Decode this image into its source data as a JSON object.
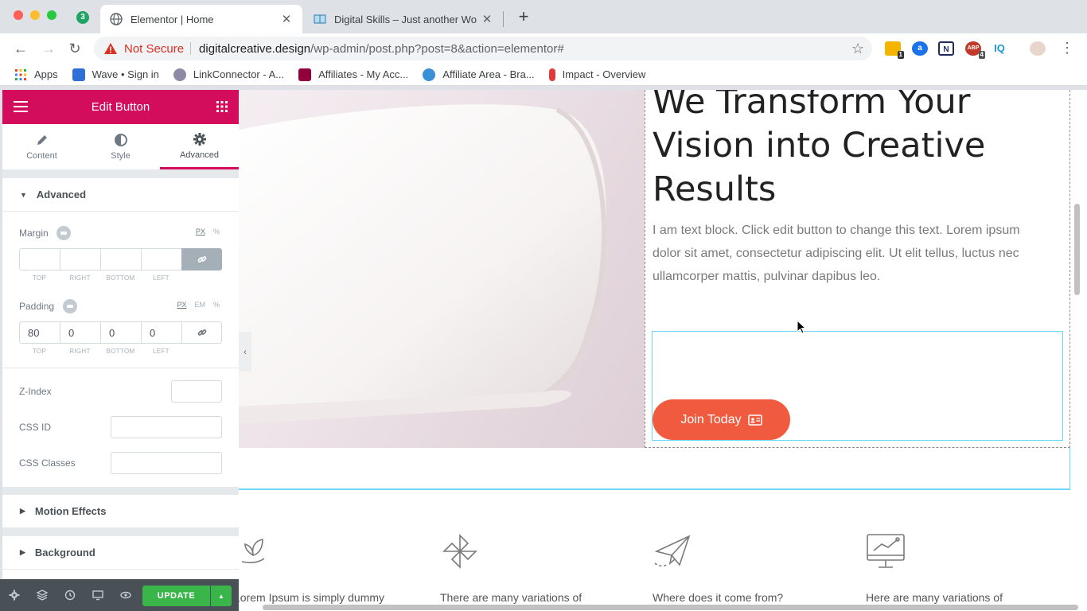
{
  "browser": {
    "pinned_badge": "3",
    "tabs": [
      {
        "title": "Elementor | Home",
        "close": "✕"
      },
      {
        "title": "Digital Skills – Just another Wo",
        "close": "✕"
      }
    ],
    "new_tab": "+",
    "address": {
      "security_text": "Not Secure",
      "domain": "digitalcreative.design",
      "path": "/wp-admin/post.php?post=8&action=elementor#"
    },
    "extensions": [
      {
        "name": "notes-extension",
        "badge": "1",
        "color": "#f5b400"
      },
      {
        "name": "a-extension",
        "color": "#1a73e8"
      },
      {
        "name": "n-extension",
        "color": "#1d2b5f"
      },
      {
        "name": "adblock-extension",
        "badge": "4",
        "color": "#c0392b"
      },
      {
        "name": "iq-extension",
        "text": "IQ",
        "color": "#1a9bd7"
      }
    ],
    "bookmarks": [
      {
        "label": "Apps",
        "icon": "apps-grid-icon",
        "color": "#ea4335"
      },
      {
        "label": "Wave • Sign in",
        "icon": "wave-icon",
        "color": "#2e6fd8"
      },
      {
        "label": "LinkConnector - A...",
        "icon": "linkconnector-icon",
        "color": "#8e8aa6"
      },
      {
        "label": "Affiliates - My Acc...",
        "icon": "affiliates-icon",
        "color": "#92003b"
      },
      {
        "label": "Affiliate Area - Bra...",
        "icon": "affiliate-area-icon",
        "color": "#3b8fd6"
      },
      {
        "label": "Impact - Overview",
        "icon": "impact-icon",
        "color": "#e03b3b"
      }
    ]
  },
  "panel": {
    "title": "Edit Button",
    "tabs": [
      {
        "label": "Content",
        "icon": "pencil-icon"
      },
      {
        "label": "Style",
        "icon": "half-circle-icon"
      },
      {
        "label": "Advanced",
        "icon": "gear-icon"
      }
    ],
    "section_advanced": "Advanced",
    "margin": {
      "label": "Margin",
      "units": [
        "PX",
        "%"
      ],
      "values": [
        "",
        "",
        "",
        ""
      ],
      "sides": [
        "TOP",
        "RIGHT",
        "BOTTOM",
        "LEFT"
      ]
    },
    "padding": {
      "label": "Padding",
      "units": [
        "PX",
        "EM",
        "%"
      ],
      "values": [
        "80",
        "0",
        "0",
        "0"
      ],
      "sides": [
        "TOP",
        "RIGHT",
        "BOTTOM",
        "LEFT"
      ]
    },
    "z_index": {
      "label": "Z-Index",
      "value": ""
    },
    "css_id": {
      "label": "CSS ID",
      "value": ""
    },
    "css_classes": {
      "label": "CSS Classes",
      "value": ""
    },
    "section_motion": "Motion Effects",
    "section_background": "Background",
    "update_label": "UPDATE"
  },
  "canvas": {
    "heading_cut": "We Transform Your",
    "heading_lines": [
      "Vision into Creative",
      "Results"
    ],
    "text_block": "I am text block. Click edit button to change this text. Lorem ipsum dolor sit amet, consectetur adipiscing elit. Ut elit tellus, luctus nec ullamcorper mattis, pulvinar dapibus leo.",
    "button_label": "Join Today",
    "button_color": "#f05a3e",
    "features": [
      {
        "icon": "plant-hand-icon",
        "text": "Lorem Ipsum is simply dummy"
      },
      {
        "icon": "pinwheel-icon",
        "text": "There are many variations of"
      },
      {
        "icon": "paper-plane-icon",
        "text": "Where does it come from?"
      },
      {
        "icon": "monitor-chart-icon",
        "text": "Here are many variations of"
      }
    ]
  },
  "colors": {
    "elementor_pink": "#d30c5c",
    "update_green": "#39b54a",
    "selection_blue": "#71d7f7"
  }
}
